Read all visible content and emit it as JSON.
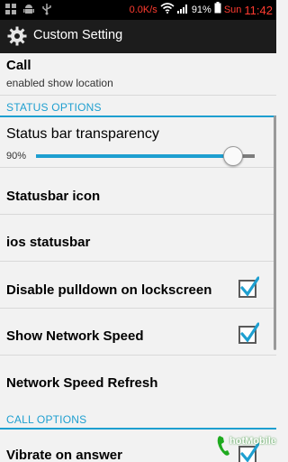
{
  "status_bar": {
    "network_speed": "0.0K/s",
    "battery_percent": "91%",
    "day": "Sun",
    "time": "11:42",
    "icons": [
      "grid-icon",
      "android-icon",
      "usb-icon",
      "wifi-icon",
      "signal-icon",
      "battery-icon"
    ]
  },
  "action_bar": {
    "title": "Custom Setting",
    "icon": "gear-icon"
  },
  "settings": {
    "call": {
      "title": "Call",
      "subtitle": "enabled show location"
    },
    "status_options_header": "STATUS OPTIONS",
    "transparency": {
      "title": "Status bar transparency",
      "value_label": "90%",
      "value": 0.9
    },
    "statusbar_icon": {
      "title": "Statusbar icon"
    },
    "ios_statusbar": {
      "title": "ios statusbar"
    },
    "disable_pulldown": {
      "title": "Disable pulldown on lockscreen",
      "checked": true
    },
    "show_network_speed": {
      "title": "Show Network Speed",
      "checked": true
    },
    "network_speed_refresh": {
      "title": "Network Speed Refresh"
    },
    "call_options_header": "CALL OPTIONS",
    "vibrate_on_answer": {
      "title": "Vibrate on answer",
      "checked": true
    }
  },
  "watermark": {
    "text": "hotMobile"
  },
  "colors": {
    "accent": "#1e9fd0",
    "status_red": "#ff3b30",
    "actionbar": "#1c1c1c",
    "background": "#f2f2f2"
  }
}
